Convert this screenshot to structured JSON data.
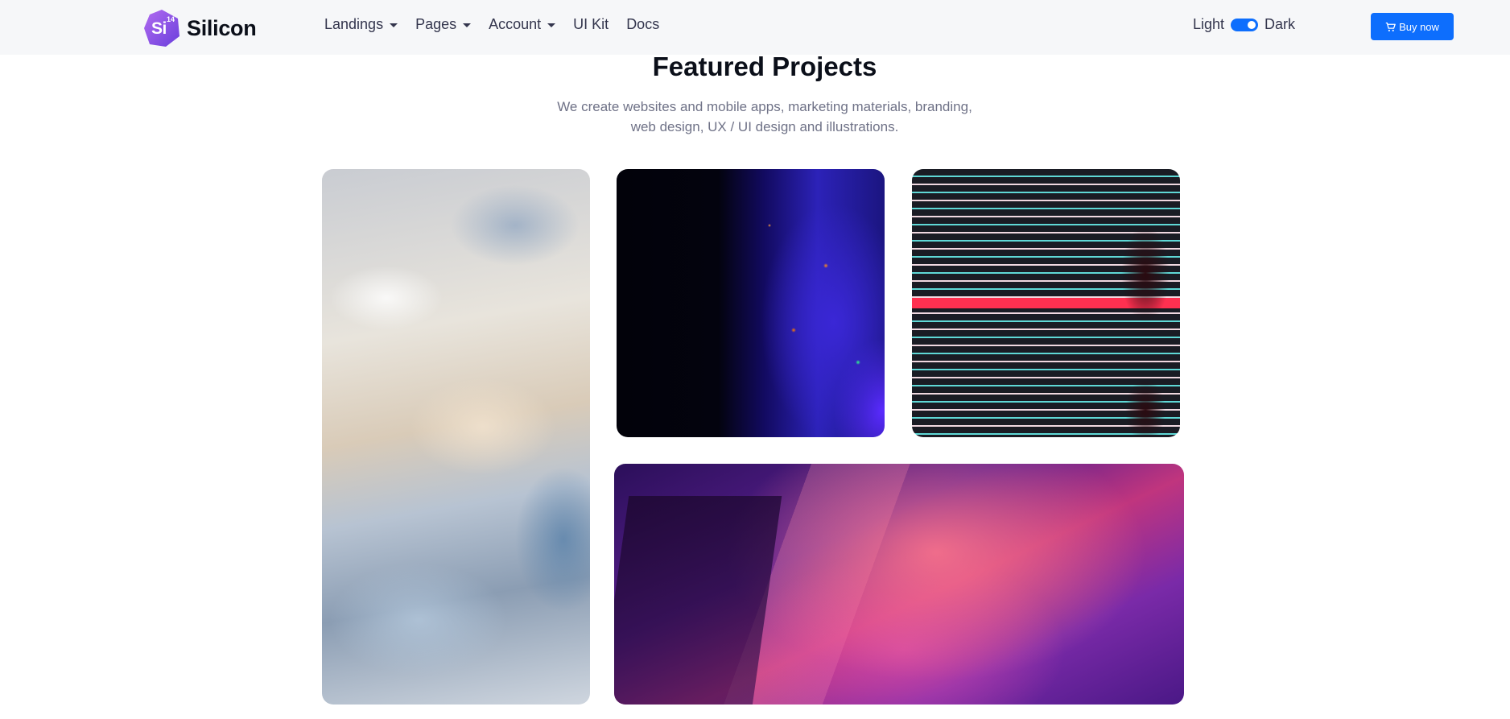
{
  "brand": {
    "name": "Silicon",
    "logo_text": "Si",
    "logo_sup": "14"
  },
  "nav": {
    "items": [
      {
        "label": "Landings",
        "dropdown": true
      },
      {
        "label": "Pages",
        "dropdown": true
      },
      {
        "label": "Account",
        "dropdown": true
      },
      {
        "label": "UI Kit",
        "dropdown": false
      },
      {
        "label": "Docs",
        "dropdown": false
      }
    ]
  },
  "theme": {
    "light_label": "Light",
    "dark_label": "Dark"
  },
  "buy": {
    "label": "Buy now",
    "icon": "cart-icon"
  },
  "section": {
    "title": "Featured Projects",
    "subtitle": "We create websites and mobile apps, marketing materials, branding, web design, UX / UI design and illustrations."
  },
  "colors": {
    "accent": "#0d6efd",
    "logo": "#8c4ee6",
    "navbar_bg": "#f6f7f9",
    "heading": "#0b0f19",
    "muted": "#6f7287"
  }
}
